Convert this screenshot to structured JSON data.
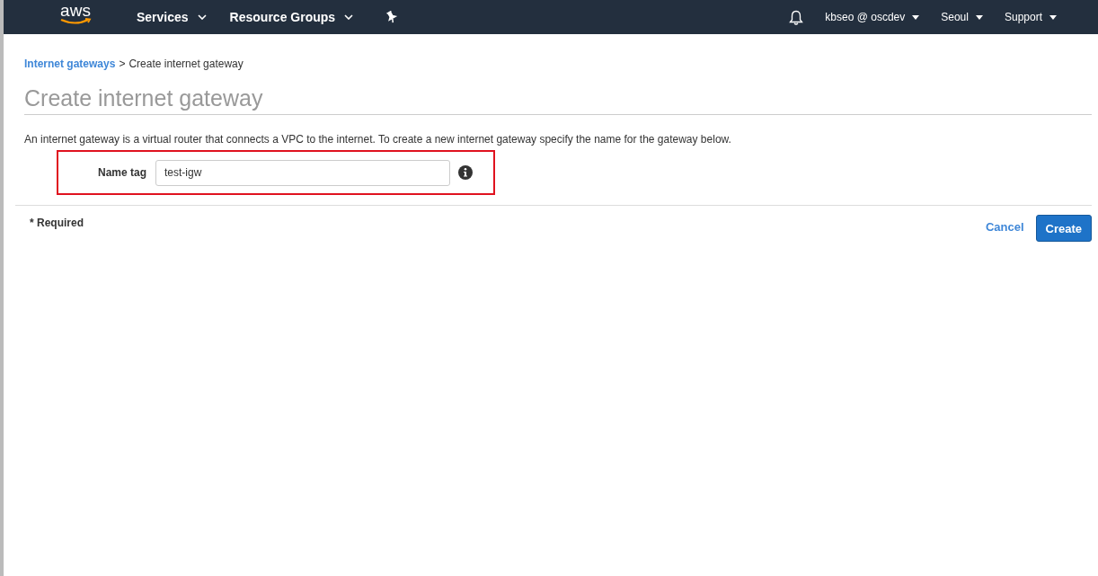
{
  "nav": {
    "logo": "aws",
    "menus": [
      {
        "label": "Services"
      },
      {
        "label": "Resource Groups"
      }
    ],
    "right_menus": [
      {
        "label": "kbseo @ oscdev"
      },
      {
        "label": "Seoul"
      },
      {
        "label": "Support"
      }
    ]
  },
  "breadcrumb": {
    "link": "Internet gateways",
    "separator": ">",
    "current": "Create internet gateway"
  },
  "title": "Create internet gateway",
  "description": "An internet gateway is a virtual router that connects a VPC to the internet. To create a new internet gateway specify the name for the gateway below.",
  "form": {
    "label": "Name tag",
    "value": "test-igw"
  },
  "required_note": "* Required",
  "buttons": {
    "cancel": "Cancel",
    "create": "Create"
  }
}
